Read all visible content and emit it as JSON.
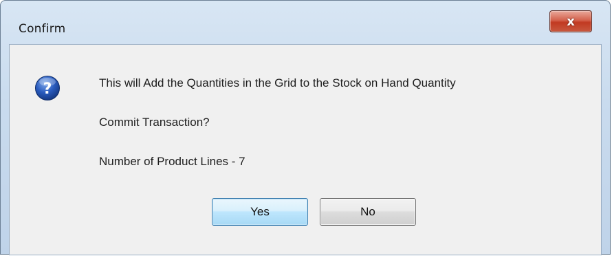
{
  "window": {
    "title": "Confirm",
    "close_label": "x"
  },
  "message": {
    "line1": "This will Add the Quantities in the Grid to the Stock on Hand Quantity",
    "line2": "Commit Transaction?",
    "line3": "Number of Product Lines - 7",
    "icon": "question-icon"
  },
  "buttons": {
    "yes_label": "Yes",
    "no_label": "No"
  },
  "colors": {
    "client_bg": "#f0f0f0",
    "frame": "#c9dbee",
    "close_red": "#c13a22",
    "icon_blue": "#1f4fa8"
  }
}
